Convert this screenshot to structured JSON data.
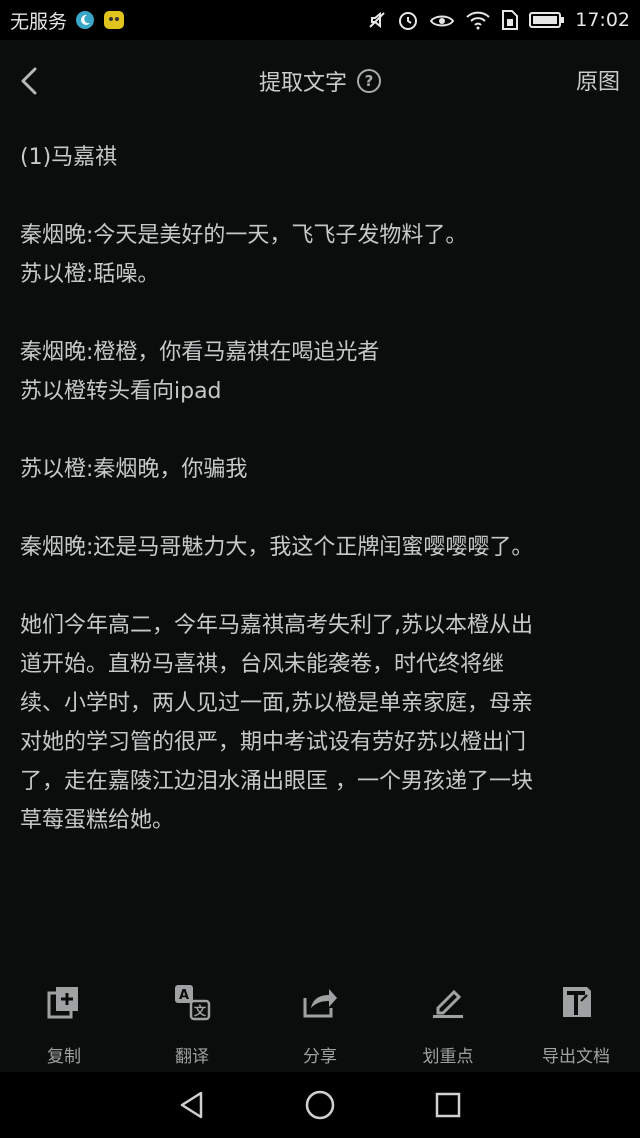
{
  "status_bar": {
    "carrier": "无服务",
    "time": "17:02",
    "icons": [
      "moon-app-icon",
      "chat-app-icon",
      "mute-icon",
      "alarm-icon",
      "eye-icon",
      "wifi-icon",
      "sim-icon",
      "battery-icon"
    ]
  },
  "header": {
    "title": "提取文字",
    "help": "?",
    "original_label": "原图"
  },
  "content": {
    "paragraphs": [
      "(1)马嘉祺",
      "",
      "秦烟晚:今天是美好的一天，飞飞子发物料了。",
      "苏以橙:聒噪。",
      "",
      "秦烟晚:橙橙，你看马嘉祺在喝追光者",
      "苏以橙转头看向ipad",
      "",
      "苏以橙:秦烟晚，你骗我",
      "",
      "秦烟晚:还是马哥魅力大，我这个正牌闰蜜嘤嘤嘤了。",
      "",
      "她们今年高二，今年马嘉祺高考失利了,苏以本橙从出",
      "道开始。直粉马喜祺，台风未能袭卷，时代终将继",
      "续、小学时，两人见过一面,苏以橙是单亲家庭，母亲",
      "对她的学习管的很严，期中考试设有劳好苏以橙出门",
      "了，走在嘉陵江边泪水涌出眼匡 ，一个男孩递了一块",
      "草莓蛋糕给她。"
    ]
  },
  "toolbar": {
    "copy": "复制",
    "translate": "翻译",
    "share": "分享",
    "highlight": "划重点",
    "export": "导出文档"
  },
  "colors": {
    "background": "#0b0d0d",
    "text": "#c6c9c9",
    "muted": "#9fa2a2"
  }
}
